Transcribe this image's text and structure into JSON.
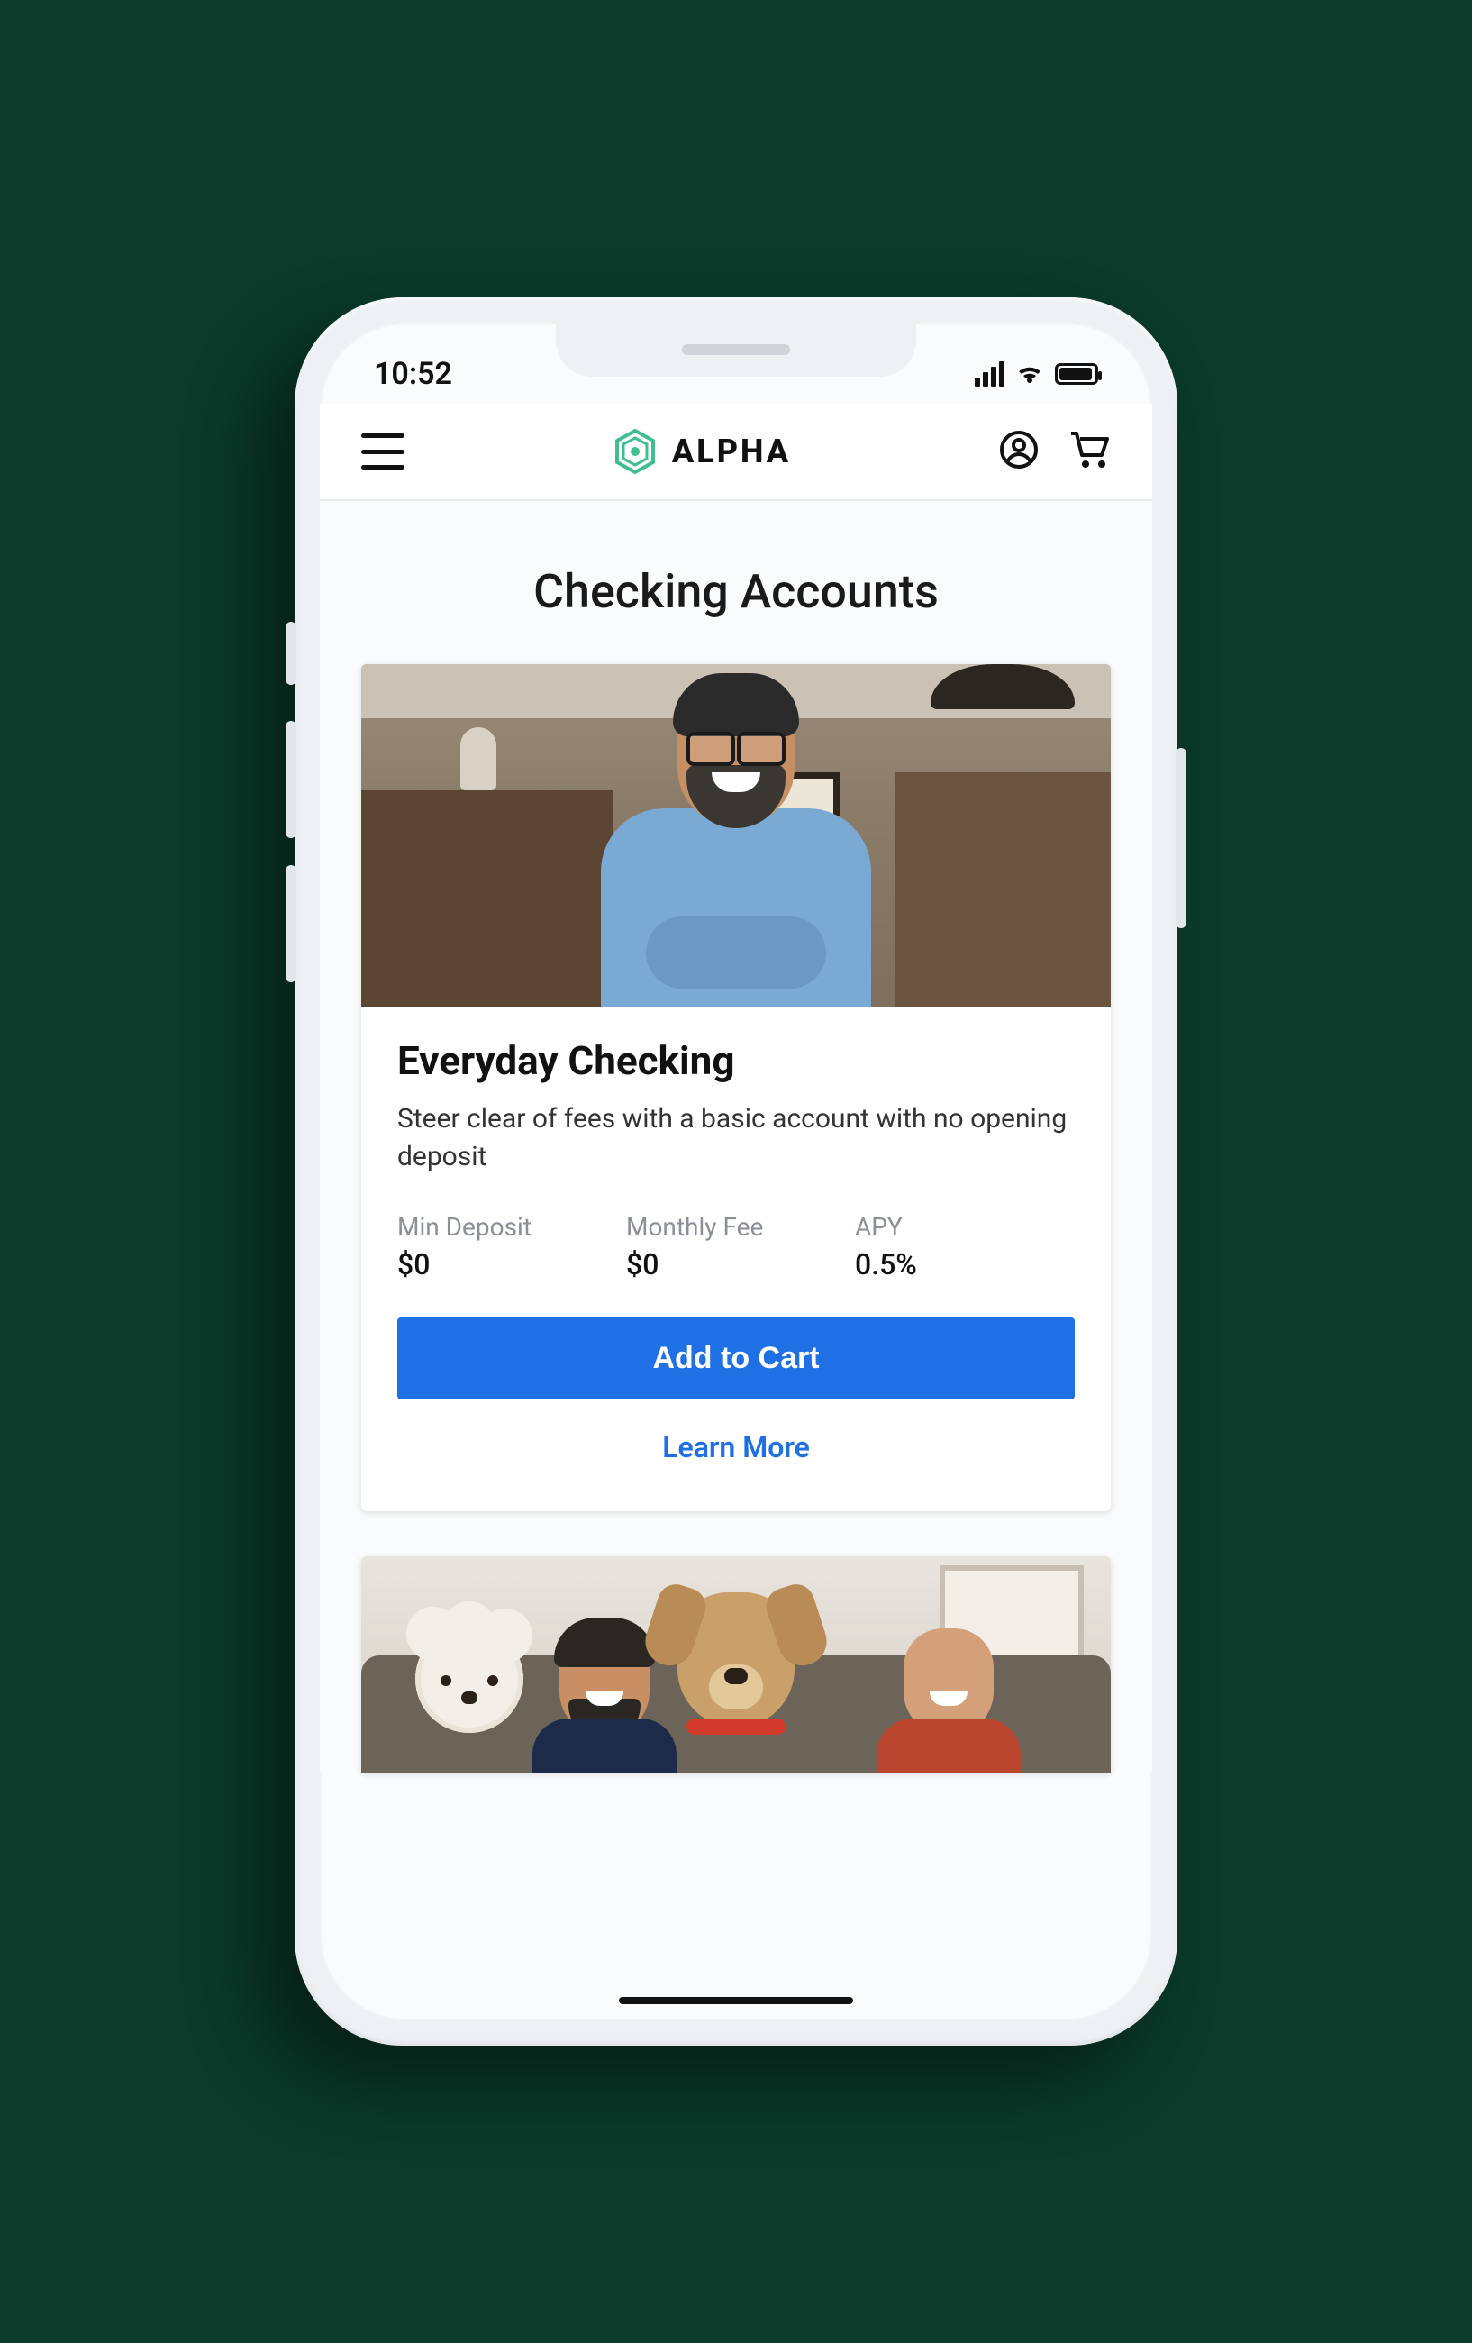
{
  "status": {
    "time": "10:52"
  },
  "header": {
    "brand": "ALPHA"
  },
  "page": {
    "title": "Checking Accounts"
  },
  "cards": [
    {
      "title": "Everyday Checking",
      "desc": "Steer clear of fees with a basic account with no opening deposit",
      "stats": {
        "min_deposit_label": "Min Deposit",
        "min_deposit_value": "$0",
        "monthly_fee_label": "Monthly Fee",
        "monthly_fee_value": "$0",
        "apy_label": "APY",
        "apy_value": "0.5%"
      },
      "cta_primary": "Add to Cart",
      "cta_secondary": "Learn More"
    }
  ],
  "colors": {
    "primary_button": "#1f6fe5",
    "brand_accent": "#3fbf8f"
  }
}
